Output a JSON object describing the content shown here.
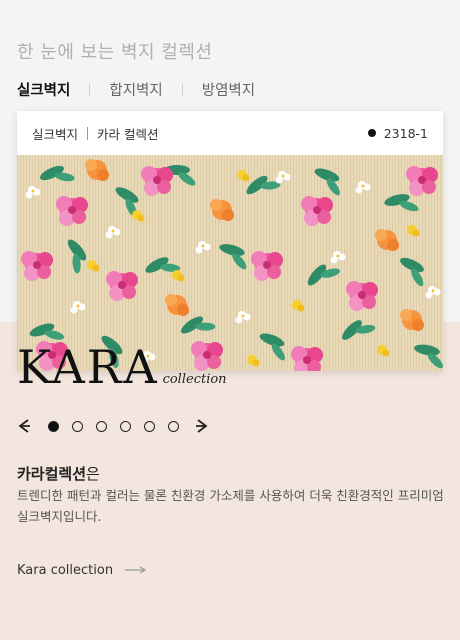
{
  "section_title": "한 눈에 보는 벽지 컬렉션",
  "tabs": [
    {
      "label": "실크벽지",
      "active": true
    },
    {
      "label": "합지벽지",
      "active": false
    },
    {
      "label": "방염벽지",
      "active": false
    }
  ],
  "card": {
    "breadcrumb_category": "실크벽지",
    "breadcrumb_collection": "카라 컬렉션",
    "product_code": "2318-1"
  },
  "logo": {
    "word": "KARA",
    "sub": "collection"
  },
  "pager": {
    "total": 6,
    "current": 1
  },
  "description": {
    "title_bold": "카라컬렉션",
    "title_suffix": "은",
    "body": "트렌디한 패턴과 컬러는 물론 친환경 가소제를 사용하여 더욱 친환경적인 프리미엄 실크벽지입니다."
  },
  "link_label": "Kara collection",
  "colors": {
    "accent_bg": "#f3e6de",
    "page_bg": "#f4f4f4"
  },
  "icons": [
    "chevron-left-icon",
    "chevron-right-icon",
    "long-arrow-right-icon"
  ]
}
